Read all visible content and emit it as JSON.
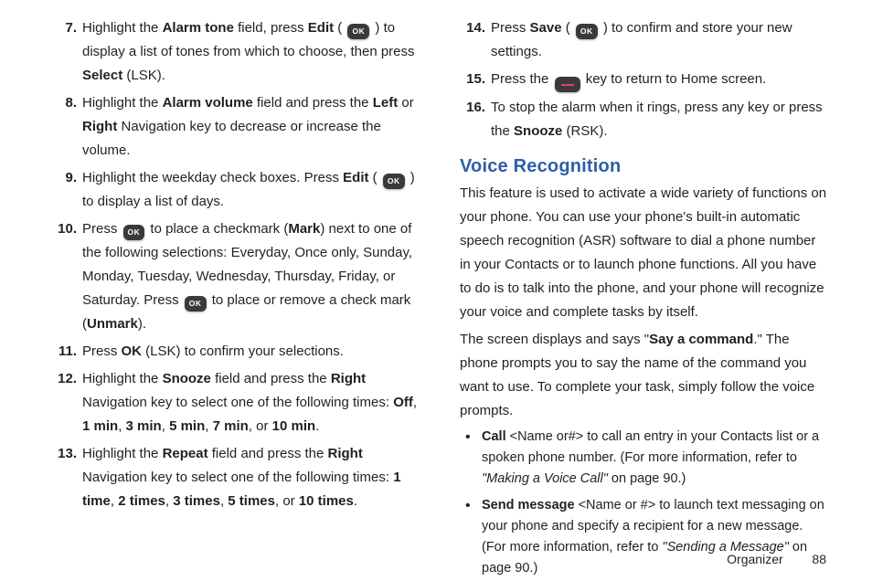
{
  "icons": {
    "ok_label": "OK"
  },
  "left": {
    "steps": [
      {
        "num": "7.",
        "parts": [
          {
            "t": "Highlight the "
          },
          {
            "t": "Alarm tone",
            "b": true
          },
          {
            "t": " field, press "
          },
          {
            "t": "Edit",
            "b": true
          },
          {
            "t": " ( "
          },
          {
            "icon": "ok"
          },
          {
            "t": " ) to display a list of tones from which to choose, then press "
          },
          {
            "t": "Select",
            "b": true
          },
          {
            "t": " (LSK)."
          }
        ]
      },
      {
        "num": "8.",
        "parts": [
          {
            "t": "Highlight the "
          },
          {
            "t": "Alarm volume",
            "b": true
          },
          {
            "t": " field and press the "
          },
          {
            "t": "Left",
            "b": true
          },
          {
            "t": " or "
          },
          {
            "t": "Right",
            "b": true
          },
          {
            "t": " Navigation key to decrease or increase the volume."
          }
        ]
      },
      {
        "num": "9.",
        "parts": [
          {
            "t": "Highlight the weekday check boxes. Press "
          },
          {
            "t": "Edit",
            "b": true
          },
          {
            "t": " ( "
          },
          {
            "icon": "ok"
          },
          {
            "t": " ) to display a list of days."
          }
        ]
      },
      {
        "num": "10.",
        "parts": [
          {
            "t": "Press "
          },
          {
            "icon": "ok"
          },
          {
            "t": " to place a checkmark ("
          },
          {
            "t": "Mark",
            "b": true
          },
          {
            "t": ") next to one of the following selections: Everyday, Once only, Sunday, Monday, Tuesday, Wednesday, Thursday, Friday, or Saturday. Press "
          },
          {
            "icon": "ok"
          },
          {
            "t": " to place or remove a check mark ("
          },
          {
            "t": "Unmark",
            "b": true
          },
          {
            "t": ")."
          }
        ]
      },
      {
        "num": "11.",
        "parts": [
          {
            "t": "Press "
          },
          {
            "t": "OK",
            "b": true
          },
          {
            "t": " (LSK) to confirm your selections."
          }
        ]
      },
      {
        "num": "12.",
        "parts": [
          {
            "t": "Highlight the "
          },
          {
            "t": "Snooze",
            "b": true
          },
          {
            "t": " field and press the "
          },
          {
            "t": "Right",
            "b": true
          },
          {
            "t": " Navigation key to select one of the following times: "
          },
          {
            "t": "Off",
            "b": true
          },
          {
            "t": ", "
          },
          {
            "t": "1 min",
            "b": true
          },
          {
            "t": ", "
          },
          {
            "t": "3 min",
            "b": true
          },
          {
            "t": ", "
          },
          {
            "t": "5 min",
            "b": true
          },
          {
            "t": ", "
          },
          {
            "t": "7 min",
            "b": true
          },
          {
            "t": ", or "
          },
          {
            "t": "10 min",
            "b": true
          },
          {
            "t": "."
          }
        ]
      },
      {
        "num": "13.",
        "parts": [
          {
            "t": "Highlight the "
          },
          {
            "t": "Repeat",
            "b": true
          },
          {
            "t": " field and press the "
          },
          {
            "t": "Right",
            "b": true
          },
          {
            "t": " Navigation key to select one of the following times: "
          },
          {
            "t": "1 time",
            "b": true
          },
          {
            "t": ", "
          },
          {
            "t": "2 times",
            "b": true
          },
          {
            "t": ", "
          },
          {
            "t": "3 times",
            "b": true
          },
          {
            "t": ", "
          },
          {
            "t": "5 times",
            "b": true
          },
          {
            "t": ", or "
          },
          {
            "t": "10 times",
            "b": true
          },
          {
            "t": "."
          }
        ]
      }
    ]
  },
  "right": {
    "steps": [
      {
        "num": "14.",
        "parts": [
          {
            "t": "Press "
          },
          {
            "t": "Save",
            "b": true
          },
          {
            "t": " ( "
          },
          {
            "icon": "ok"
          },
          {
            "t": " ) to confirm and store your new settings."
          }
        ]
      },
      {
        "num": "15.",
        "parts": [
          {
            "t": "Press the "
          },
          {
            "icon": "home"
          },
          {
            "t": " key to return to Home screen."
          }
        ]
      },
      {
        "num": "16.",
        "parts": [
          {
            "t": "To stop the alarm when it rings, press any key or press the "
          },
          {
            "t": "Snooze",
            "b": true
          },
          {
            "t": " (RSK)."
          }
        ]
      }
    ],
    "section_title": "Voice Recognition",
    "para1": "This feature is used to activate a wide variety of functions on your phone. You can use your phone's built-in automatic speech recognition (ASR) software to dial a phone number in your Contacts or to launch phone functions. All you have to do is to talk into the phone, and your phone will recognize your voice and complete tasks by itself.",
    "para2_parts": [
      {
        "t": "The screen displays and says \""
      },
      {
        "t": "Say a command",
        "b": true
      },
      {
        "t": ".\" The phone prompts you to say the name of the command you want to use. To complete your task, simply follow the voice prompts."
      }
    ],
    "bullets": [
      {
        "parts": [
          {
            "t": "Call",
            "b": true
          },
          {
            "t": " <Name or#> to call an entry in your Contacts list or a spoken phone number. (For more information, refer to "
          },
          {
            "t": "\"Making a Voice Call\"",
            "i": true
          },
          {
            "t": "  on page 90.)"
          }
        ]
      },
      {
        "parts": [
          {
            "t": "Send message",
            "b": true
          },
          {
            "t": " <Name or #> to launch text messaging on your phone and specify a recipient for a new message. (For more information, refer to "
          },
          {
            "t": "\"Sending a Message\"",
            "i": true
          },
          {
            "t": "  on page 90.)"
          }
        ]
      }
    ]
  },
  "footer": {
    "section": "Organizer",
    "page": "88"
  }
}
